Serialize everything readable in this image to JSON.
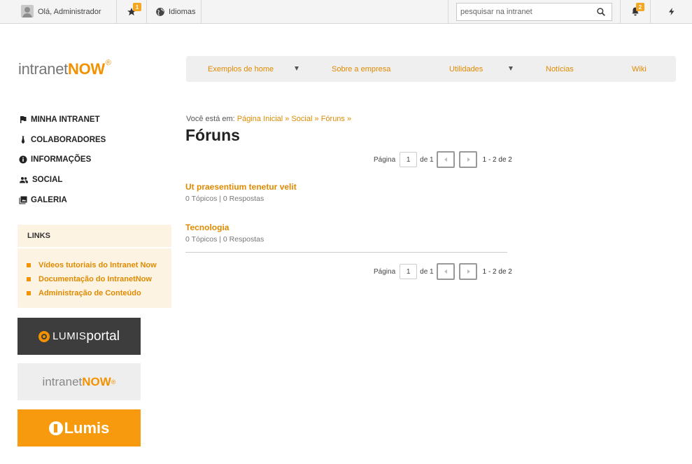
{
  "topbar": {
    "greeting": "Olá, Administrador",
    "favorites_badge": "1",
    "languages_label": "Idiomas",
    "search_placeholder": "pesquisar na intranet",
    "notifications_badge": "2"
  },
  "logo": {
    "part1": "intranet",
    "part2": "NOW",
    "mark": "®"
  },
  "nav": {
    "items": [
      {
        "label": "Exemplos de home",
        "has_dropdown": true
      },
      {
        "label": "Sobre a empresa",
        "has_dropdown": false
      },
      {
        "label": "Utilidades",
        "has_dropdown": true
      },
      {
        "label": "Notícias",
        "has_dropdown": false
      },
      {
        "label": "Wiki",
        "has_dropdown": false
      }
    ]
  },
  "sidebar": {
    "items": [
      {
        "label": "MINHA INTRANET",
        "icon": "flag-icon"
      },
      {
        "label": "COLABORADORES",
        "icon": "tie-icon"
      },
      {
        "label": "INFORMAÇÕES",
        "icon": "info-icon"
      },
      {
        "label": "SOCIAL",
        "icon": "people-icon"
      },
      {
        "label": "GALERIA",
        "icon": "gallery-icon"
      }
    ],
    "links": {
      "title": "LINKS",
      "items": [
        "Vídeos tutoriais do Intranet Now",
        "Documentação do IntranetNow",
        "Administração de Conteúdo"
      ]
    },
    "banners": {
      "lumisportal": {
        "part1": "LUMIS",
        "part2": "portal"
      },
      "intranetnow": {
        "part1": "intranet",
        "part2": "NOW",
        "mark": "®"
      },
      "lumis": "Lumis"
    }
  },
  "breadcrumb": {
    "prefix": "Você está em:",
    "items": [
      "Página Inicial",
      "Social",
      "Fóruns"
    ],
    "separator": "»"
  },
  "page_title": "Fóruns",
  "pager": {
    "page_label": "Página",
    "current_page": "1",
    "of_label": "de 1",
    "range": "1 - 2 de 2"
  },
  "forums": [
    {
      "title": "Ut praesentium tenetur velit",
      "meta": "0 Tópicos | 0 Respostas"
    },
    {
      "title": "Tecnologia",
      "meta": "0 Tópicos | 0 Respostas"
    }
  ],
  "colors": {
    "accent": "#f39200",
    "link": "#e08a00",
    "links_box_bg": "#fdf3e2"
  }
}
